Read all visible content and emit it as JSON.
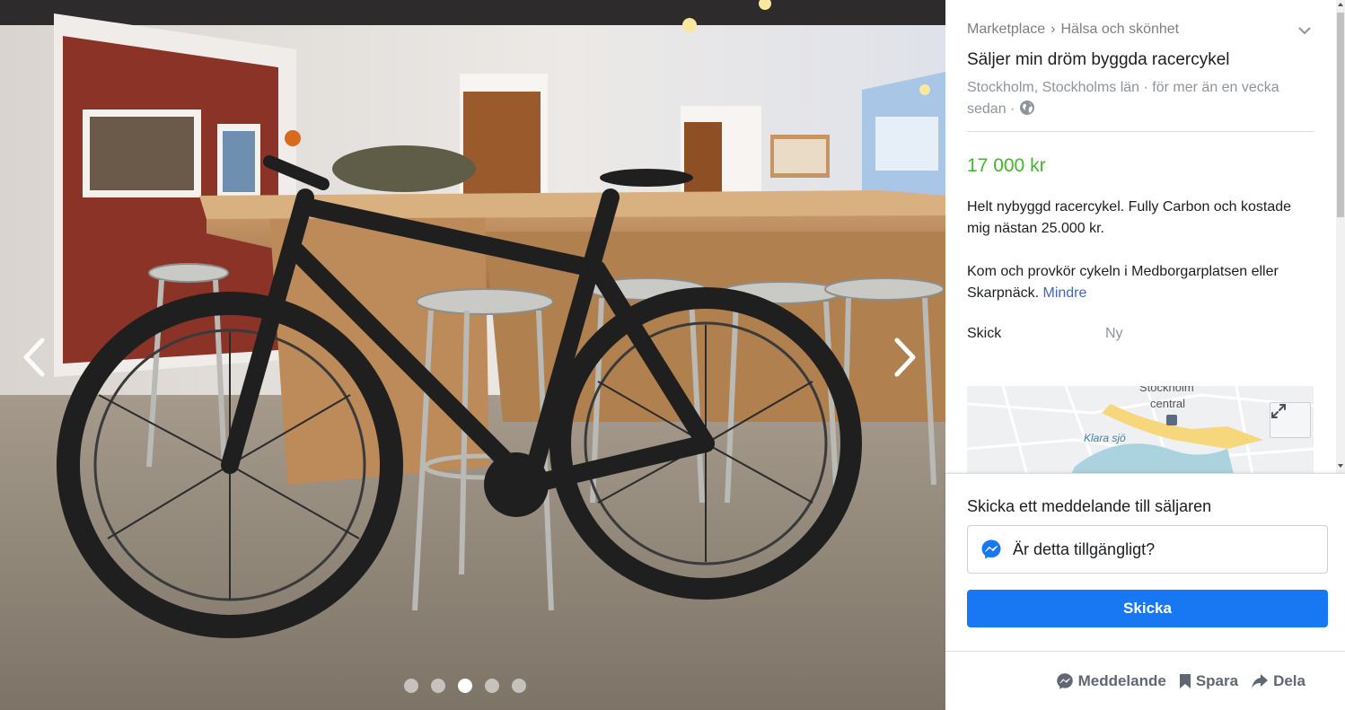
{
  "viewer": {
    "photo_count": 5,
    "active_photo_index": 2
  },
  "listing": {
    "breadcrumb": [
      "Marketplace",
      "Hälsa och skönhet"
    ],
    "breadcrumb_separator": "›",
    "title": "Säljer min dröm byggda racercykel",
    "location_time": "Stockholm, Stockholms län · för mer än en vecka sedan ·",
    "price": "17 000 kr",
    "description": [
      "Helt nybyggd racercykel. Fully Carbon och kostade mig nästan 25.000 kr.",
      "Kom och provkör cykeln i Medborgarplatsen eller Skarpnäck."
    ],
    "less_link": "Mindre",
    "condition_label": "Skick",
    "condition_value": "Ny"
  },
  "map": {
    "labels": [
      "Stockholm",
      "central",
      "Klara sjö"
    ]
  },
  "message": {
    "title": "Skicka ett meddelande till säljaren",
    "input_value": "Är detta tillgängligt?",
    "send_label": "Skicka"
  },
  "actions": {
    "message": "Meddelande",
    "save": "Spara",
    "share": "Dela"
  },
  "colors": {
    "price": "#42b72a",
    "link": "#4267b2",
    "primary_button": "#1877f2"
  }
}
